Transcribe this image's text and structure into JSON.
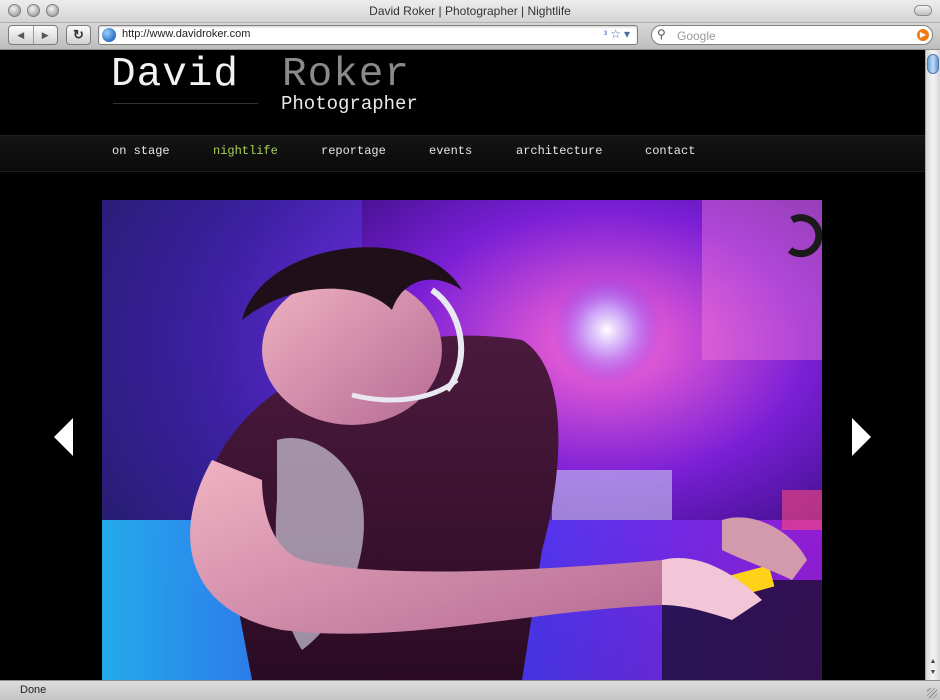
{
  "window": {
    "title": "David Roker | Photographer | Nightlife"
  },
  "toolbar": {
    "url": "http://www.davidroker.com",
    "search_placeholder": "Google",
    "icons": [
      "back-icon",
      "forward-icon",
      "reload-icon",
      "rss-icon",
      "star-icon",
      "dropdown-icon",
      "search-icon",
      "search-go-icon"
    ]
  },
  "site": {
    "name_first": "David",
    "name_last": "Roker",
    "tagline": "Photographer",
    "nav": [
      {
        "label": "on stage"
      },
      {
        "label": "nightlife",
        "active": true
      },
      {
        "label": "reportage"
      },
      {
        "label": "events"
      },
      {
        "label": "architecture"
      },
      {
        "label": "contact"
      }
    ],
    "colors": {
      "background": "#000000",
      "nav_text": "#e6e6e6",
      "nav_active": "#a9d25a",
      "name_last": "#8a8a8a"
    }
  },
  "gallery": {
    "photo_subject": "DJ mixing at turntables under purple and blue club lights",
    "prev_icon": "prev-arrow-icon",
    "next_icon": "next-arrow-icon"
  },
  "status": {
    "text": "Done"
  }
}
